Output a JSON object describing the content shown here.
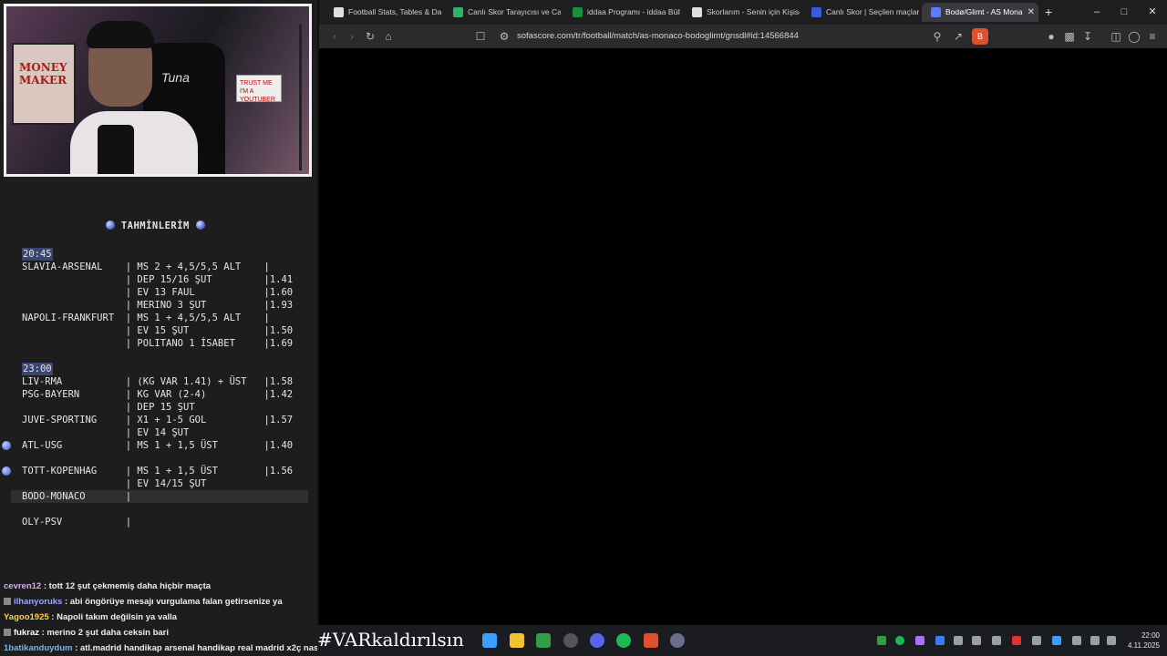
{
  "stream": {
    "webcam": {
      "poster_text": "MONEY MAKER",
      "chair_text": "Tuna",
      "sign_text": "TRUST ME I'M A YOUTUBER"
    },
    "predictions": {
      "title": "TAHMİNLERİM",
      "lines": [
        {
          "text": "20:45",
          "time": true
        },
        {
          "text": "SLAVIA-ARSENAL    | MS 2 + 4,5/5,5 ALT    |"
        },
        {
          "text": "                  | DEP 15/16 ŞUT         |1.41"
        },
        {
          "text": "                  | EV 13 FAUL            |1.60"
        },
        {
          "text": "                  | MERINO 3 ŞUT          |1.93"
        },
        {
          "text": "NAPOLI-FRANKFURT  | MS 1 + 4,5/5,5 ALT    |"
        },
        {
          "text": "                  | EV 15 ŞUT             |1.50"
        },
        {
          "text": "                  | POLITANO 1 İSABET     |1.69"
        },
        {
          "text": ""
        },
        {
          "text": "23:00",
          "time": true
        },
        {
          "text": "LIV-RMA           | (KG VAR 1.41) + ÜST   |1.58"
        },
        {
          "text": "PSG-BAYERN        | KG VAR (2-4)          |1.42"
        },
        {
          "text": "                  | DEP 15 ŞUT"
        },
        {
          "text": "JUVE-SPORTING     | X1 + 1-5 GOL          |1.57"
        },
        {
          "text": "                  | EV 14 ŞUT"
        },
        {
          "text": "ATL-USG           | MS 1 + 1,5 ÜST        |1.40",
          "dot": true
        },
        {
          "text": ""
        },
        {
          "text": "TOTT-KOPENHAG     | MS 1 + 1,5 ÜST        |1.56",
          "dot": true
        },
        {
          "text": "                  | EV 14/15 ŞUT"
        },
        {
          "text": "BODO-MONACO       |",
          "highlight": true
        },
        {
          "text": ""
        },
        {
          "text": "OLY-PSV           |"
        }
      ]
    },
    "chat": [
      {
        "user": "cevren12",
        "msg": " : tott 12 şut çekmemiş daha hiçbir maçta",
        "cls": "u1",
        "icon": false
      },
      {
        "user": "ilhanyoruks",
        "msg": " : abi öngörüye mesajı vurgulama falan getirsenize ya",
        "cls": "u2",
        "icon": true
      },
      {
        "user": "Yagoo1925",
        "msg": " : Napoli takım değilsin ya valla",
        "cls": "u3",
        "icon": false
      },
      {
        "user": "fukraz",
        "msg": " : merino 2 şut daha ceksin bari",
        "cls": "u4",
        "icon": true
      },
      {
        "user": "1batikanduydum",
        "msg": " : atl.madrid handikap arsenal handikap real madrid x2ç nasıl ?",
        "cls": "u5",
        "icon": false
      }
    ]
  },
  "browser": {
    "tabs": [
      {
        "label": "Football Stats, Tables & Dat",
        "icon": "flashscore-icon",
        "color": "#e0e0e0"
      },
      {
        "label": "Canlı Skor Tarayıcısı ve Canl",
        "icon": "livescore-icon",
        "color": "#2fb36b"
      },
      {
        "label": "iddaa Programı - iddaa Bült",
        "icon": "iddaa-icon",
        "color": "#1e8f3e"
      },
      {
        "label": "Skorlarım - Senin için Kişise",
        "icon": "scores-icon",
        "color": "#e0e0e0"
      },
      {
        "label": "Canlı Skor | Seçilen maçlar",
        "icon": "mackolik-icon",
        "color": "#3b5bdb"
      },
      {
        "label": "Bodø/Glimt - AS Mona",
        "icon": "sofascore-icon",
        "color": "#5b7cff",
        "active": true
      }
    ],
    "url": "sofascore.com/tr/football/match/as-monaco-bodoglimt/gnsdl#id:14566844"
  },
  "taskbar": {
    "banner": "#VARkaldırılsın",
    "time": "22:00",
    "date": "4.11.2025"
  }
}
